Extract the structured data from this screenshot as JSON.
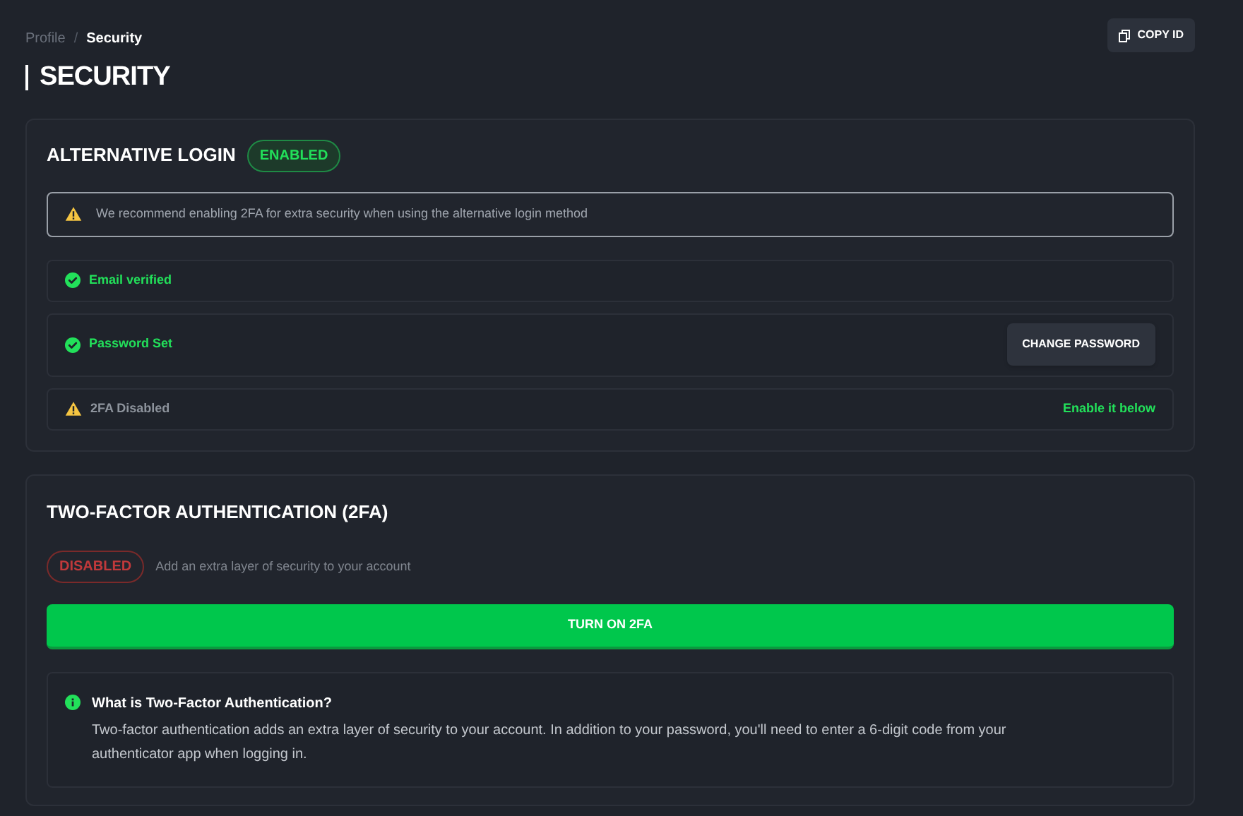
{
  "breadcrumb": [
    {
      "label": "Profile",
      "selected": false
    },
    {
      "label": "Security",
      "selected": true
    }
  ],
  "breadcrumb_separator": "/",
  "copy_button": "COPY ID",
  "title": "SECURITY",
  "alternative_login": {
    "title": "ALTERNATIVE LOGIN",
    "badge": {
      "label": "ENABLED",
      "kind": "enabled"
    },
    "notice": "We recommend enabling 2FA for extra security when using the alternative login method",
    "rows": [
      {
        "kind": "success",
        "label": "Email verified"
      },
      {
        "kind": "success",
        "label": "Password Set",
        "button": "CHANGE PASSWORD"
      },
      {
        "kind": "warning",
        "label": "2FA Disabled",
        "link": "Enable it below"
      }
    ]
  },
  "two_factor": {
    "title": "TWO-FACTOR AUTHENTICATION (2FA)",
    "badge": {
      "label": "DISABLED",
      "kind": "disabled"
    },
    "description": "Add an extra layer of security to your account",
    "button": "TURN ON 2FA",
    "info": {
      "title": "What is Two-Factor Authentication?",
      "text": "Two-factor authentication adds an extra layer of security to your account. In addition to your password, you'll need to enter a 6-digit code from your authenticator app when logging in."
    }
  }
}
